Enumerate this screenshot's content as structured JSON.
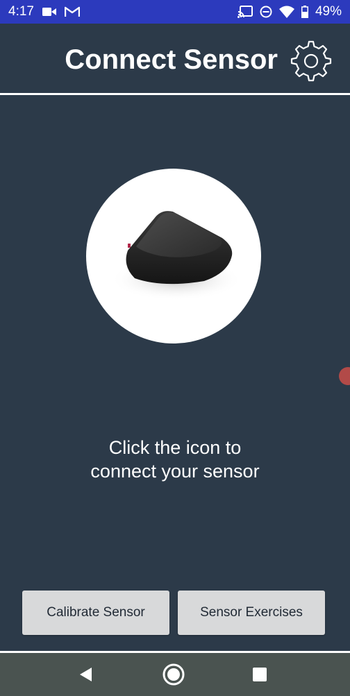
{
  "status_bar": {
    "time": "4:17",
    "battery_percent": "49%",
    "icons_left": [
      "video-camera-icon",
      "gmail-icon"
    ],
    "icons_right": [
      "cast-icon",
      "do-not-disturb-icon",
      "wifi-icon",
      "battery-icon"
    ]
  },
  "header": {
    "title": "Connect Sensor",
    "settings_icon": "gear-icon"
  },
  "main": {
    "sensor_image": "sensor-device",
    "instruction_line1": "Click the icon to",
    "instruction_line2": "connect your sensor"
  },
  "actions": {
    "calibrate_label": "Calibrate Sensor",
    "exercises_label": "Sensor Exercises"
  },
  "nav_bar": {
    "icons": [
      "back-icon",
      "home-icon",
      "recents-icon"
    ]
  },
  "colors": {
    "background": "#2c3a49",
    "status_bar": "#2c3abd",
    "button_bg": "#d8d9da",
    "button_text": "#222b36",
    "nav_bar": "#4a5350"
  }
}
